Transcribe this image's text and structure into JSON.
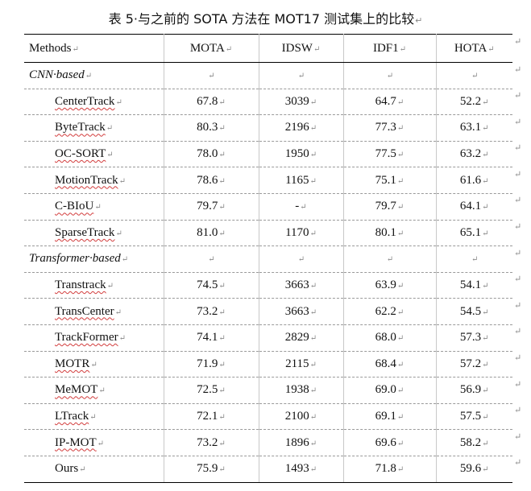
{
  "caption": "表 5·与之前的 SOTA 方法在 MOT17 测试集上的比较",
  "para_mark": "↵",
  "headers": [
    "Methods",
    "MOTA",
    "IDSW",
    "IDF1",
    "HOTA"
  ],
  "groups": [
    "CNN·based",
    "Transformer·based"
  ],
  "rows": [
    [
      "CenterTrack",
      "67.8",
      "3039",
      "64.7",
      "52.2"
    ],
    [
      "ByteTrack",
      "80.3",
      "2196",
      "77.3",
      "63.1"
    ],
    [
      "OC-SORT",
      "78.0",
      "1950",
      "77.5",
      "63.2"
    ],
    [
      "MotionTrack",
      "78.6",
      "1165",
      "75.1",
      "61.6"
    ],
    [
      "C-BIoU",
      "79.7",
      "-",
      "79.7",
      "64.1"
    ],
    [
      "SparseTrack",
      "81.0",
      "1170",
      "80.1",
      "65.1"
    ],
    [
      "Transtrack",
      "74.5",
      "3663",
      "63.9",
      "54.1"
    ],
    [
      "TransCenter",
      "73.2",
      "3663",
      "62.2",
      "54.5"
    ],
    [
      "TrackFormer",
      "74.1",
      "2829",
      "68.0",
      "57.3"
    ],
    [
      "MOTR",
      "71.9",
      "2115",
      "68.4",
      "57.2"
    ],
    [
      "MeMOT",
      "72.5",
      "1938",
      "69.0",
      "56.9"
    ],
    [
      "LTrack",
      "72.1",
      "2100",
      "69.1",
      "57.5"
    ],
    [
      "IP-MOT",
      "73.2",
      "1896",
      "69.6",
      "58.2"
    ],
    [
      "Ours",
      "75.9",
      "1493",
      "71.8",
      "59.6"
    ]
  ]
}
